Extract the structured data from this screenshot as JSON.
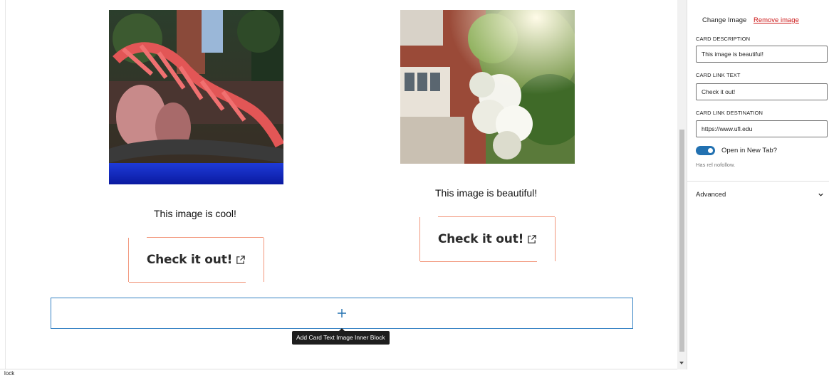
{
  "cards": [
    {
      "image_alt": "Red sculpture lit at night with crowd",
      "description": "This image is cool!",
      "button_label": "Check it out!"
    },
    {
      "image_alt": "White flowers in front of brick building",
      "description": "This image is beautiful!",
      "button_label": "Check it out!"
    }
  ],
  "appender": {
    "tooltip": "Add Card Text Image Inner Block",
    "icon": "plus-icon"
  },
  "sidebar": {
    "change_image": "Change Image",
    "remove_image": "Remove image",
    "description_label": "CARD DESCRIPTION",
    "description_value": "This image is beautiful!",
    "link_text_label": "CARD LINK TEXT",
    "link_text_value": "Check it out!",
    "link_dest_label": "CARD LINK DESTINATION",
    "link_dest_value": "https://www.ufl.edu",
    "new_tab_label": "Open in New Tab?",
    "new_tab_enabled": true,
    "rel_help": "Has rel nofollow.",
    "advanced_label": "Advanced"
  },
  "statusbar": {
    "breadcrumb": "lock"
  },
  "colors": {
    "accent": "#2271b1",
    "button_border": "#f2977c",
    "remove_link": "#cc1818",
    "appender_border": "#3582c4"
  }
}
